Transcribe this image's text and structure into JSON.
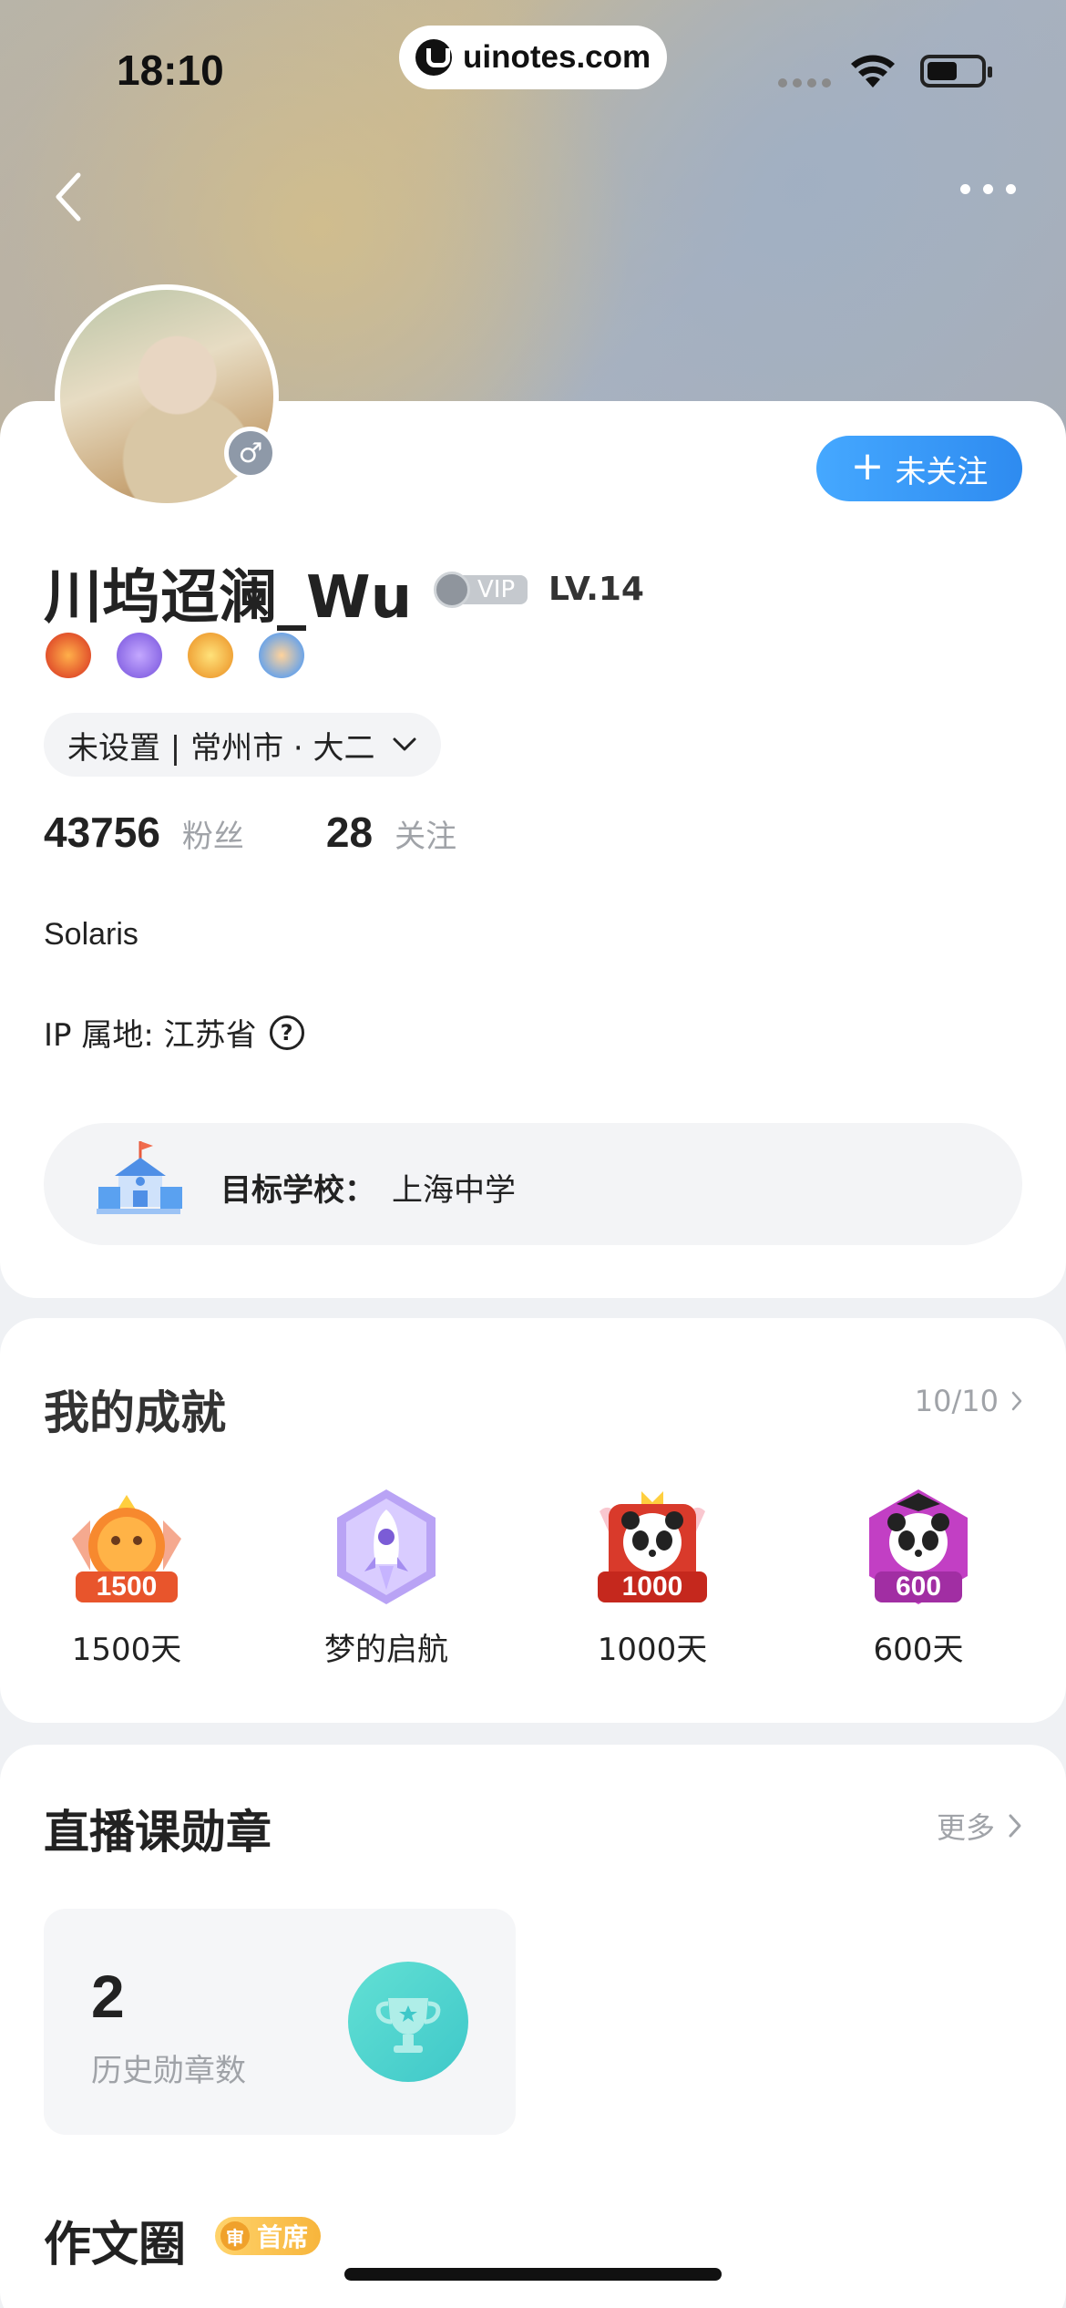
{
  "status_bar": {
    "time": "18:10",
    "url": "uinotes.com"
  },
  "nav": {
    "back_icon": "chevron-left-icon",
    "more_icon": "more-dots-icon"
  },
  "profile": {
    "gender_icon": "male-icon",
    "gender_symbol": "♂",
    "follow_button": "未关注",
    "follow_plus": "+",
    "username": "川坞迢澜_Wu",
    "vip": "VIP",
    "level": "LV.14",
    "location": "未设置 | 常州市 · 大二",
    "followers_count": "43756",
    "followers_label": "粉丝",
    "following_count": "28",
    "following_label": "关注",
    "bio": "Solaris",
    "ip_location": "IP 属地: 江苏省",
    "help_symbol": "?",
    "school_label": "目标学校：",
    "school_value": "上海中学"
  },
  "achievements": {
    "title": "我的成就",
    "count": "10/10",
    "items": [
      {
        "label": "1500天",
        "icon": "badge-1500-icon",
        "number": "1500",
        "color": "#e8552c"
      },
      {
        "label": "梦的启航",
        "icon": "rocket-badge-icon",
        "number": "",
        "color": "#a488f0"
      },
      {
        "label": "1000天",
        "icon": "panda-1000-badge-icon",
        "number": "1000",
        "color": "#d93a2b"
      },
      {
        "label": "600天",
        "icon": "panda-600-badge-icon",
        "number": "600",
        "color": "#c23fc4"
      }
    ]
  },
  "live_badges": {
    "title": "直播课勋章",
    "more": "更多",
    "count": "2",
    "count_label": "历史勋章数"
  },
  "essay_circle": {
    "title": "作文圈",
    "tag_icon": "审",
    "tag": "首席"
  }
}
